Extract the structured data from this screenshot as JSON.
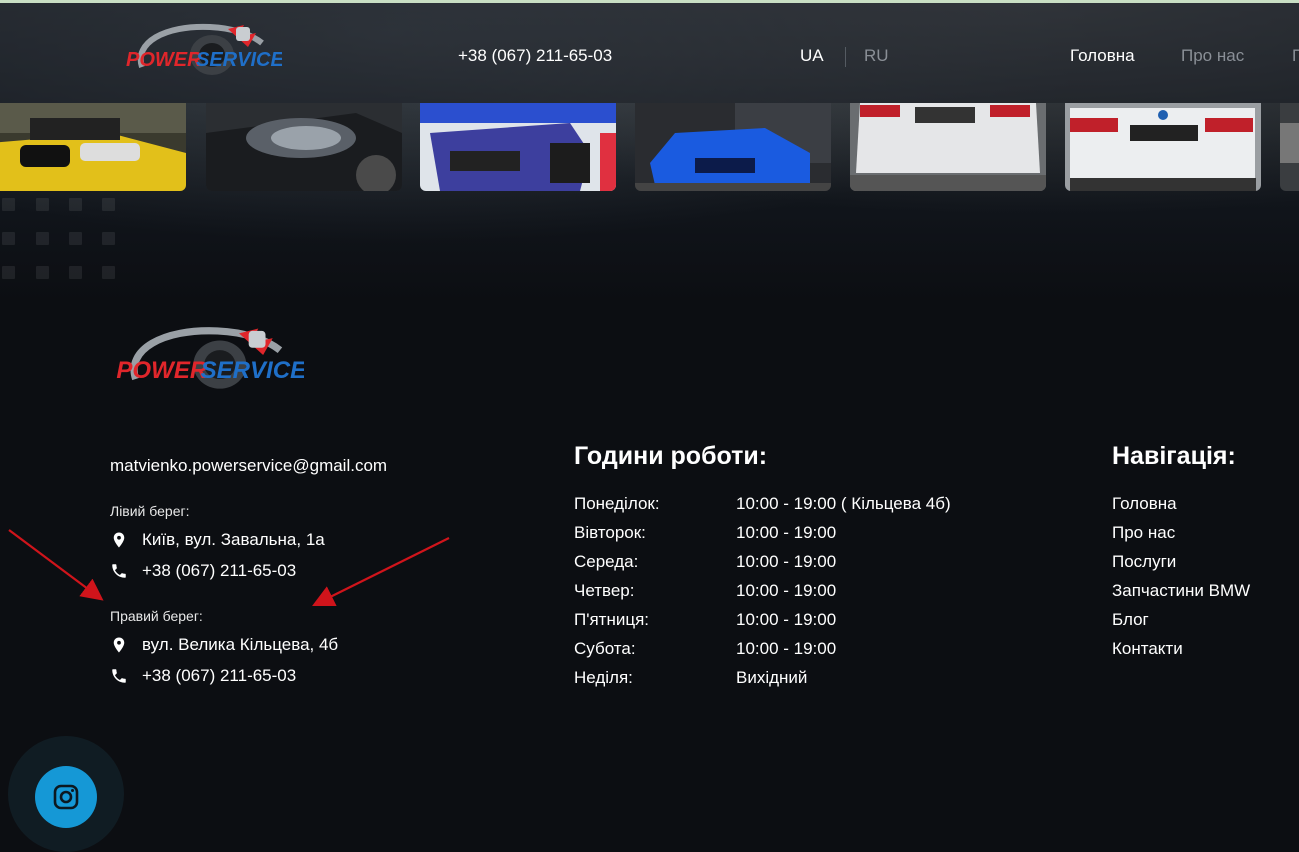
{
  "header": {
    "logo_alt": "PowerService",
    "phone": "+38 (067) 211-65-03",
    "lang_ua": "UA",
    "lang_ru": "RU",
    "nav": [
      "Головна",
      "Про нас",
      "П"
    ]
  },
  "gallery": [
    "yellow-bmw-engine",
    "black-bmw-headlight",
    "blue-bmw-on-lift",
    "blue-bmw-coupe",
    "white-bmw-rear",
    "white-bmw-x1-rear",
    "partial-car"
  ],
  "footer": {
    "email": "matvienko.powerservice@gmail.com",
    "left_bank": {
      "label": "Лівий берег:",
      "address": "Київ, вул. Завальна, 1а",
      "phone": "+38 (067) 211-65-03"
    },
    "right_bank": {
      "label": "Правий берег:",
      "address": "вул. Велика Кільцева, 4б",
      "phone": "+38 (067) 211-65-03"
    },
    "hours_title": "Години роботи:",
    "hours": [
      {
        "day": "Понеділок:",
        "time": "10:00 - 19:00 ( Кільцева 4б)"
      },
      {
        "day": "Вівторок:",
        "time": "10:00 - 19:00"
      },
      {
        "day": "Середа:",
        "time": "10:00 - 19:00"
      },
      {
        "day": "Четвер:",
        "time": "10:00 - 19:00"
      },
      {
        "day": "П'ятниця:",
        "time": "10:00 - 19:00"
      },
      {
        "day": "Субота:",
        "time": "10:00 - 19:00"
      },
      {
        "day": "Неділя:",
        "time": "Вихідний"
      }
    ],
    "nav_title": "Навігація:",
    "nav": [
      "Головна",
      "Про нас",
      "Послуги",
      "Запчастини BMW",
      "Блог",
      "Контакти"
    ]
  },
  "colors": {
    "logo_red": "#e0262b",
    "logo_blue": "#1f6fc8",
    "instagram": "#1598d6",
    "arrow": "#d0141b"
  },
  "icons": {
    "location": "map-pin-icon",
    "phone": "phone-icon",
    "social": "instagram-icon"
  }
}
